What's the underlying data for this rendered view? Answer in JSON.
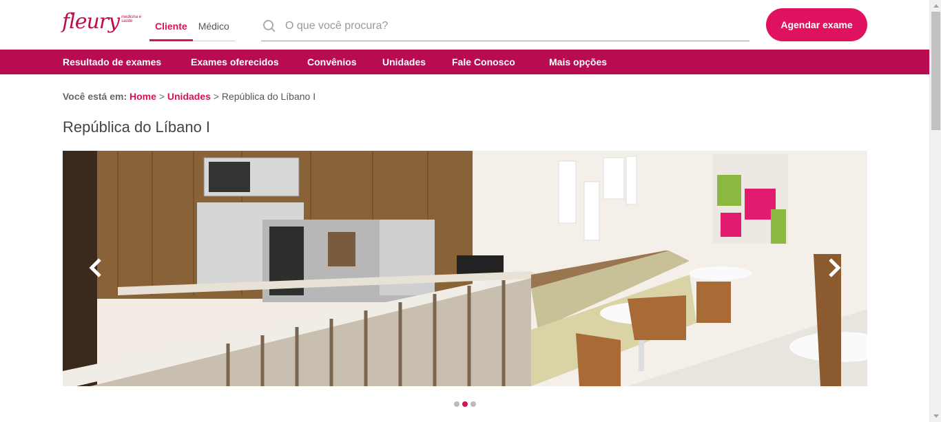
{
  "header": {
    "logo_text": "fleury",
    "logo_tagline": "medicina e saúde",
    "tabs": [
      {
        "label": "Cliente",
        "active": true
      },
      {
        "label": "Médico",
        "active": false
      }
    ],
    "search": {
      "placeholder": "O que você procura?",
      "value": "",
      "icon": "search-icon"
    },
    "cta_label": "Agendar exame"
  },
  "nav": {
    "items": [
      {
        "label": "Resultado de exames"
      },
      {
        "label": "Exames oferecidos"
      },
      {
        "label": "Convênios"
      },
      {
        "label": "Unidades"
      },
      {
        "label": "Fale Conosco"
      },
      {
        "label": "Mais opções"
      }
    ]
  },
  "breadcrumb": {
    "prefix": "Você está em:",
    "items": [
      {
        "label": "Home"
      },
      {
        "label": "Unidades"
      }
    ],
    "separator": ">",
    "current": "República do Líbano I"
  },
  "page": {
    "title": "República do Líbano I"
  },
  "carousel": {
    "prev_icon": "chevron-left-icon",
    "next_icon": "chevron-right-icon",
    "dots_count": 3,
    "active_dot": 2
  },
  "colors": {
    "brand": "#b90b4f",
    "accent": "#e0115f",
    "link": "#d4145a"
  }
}
